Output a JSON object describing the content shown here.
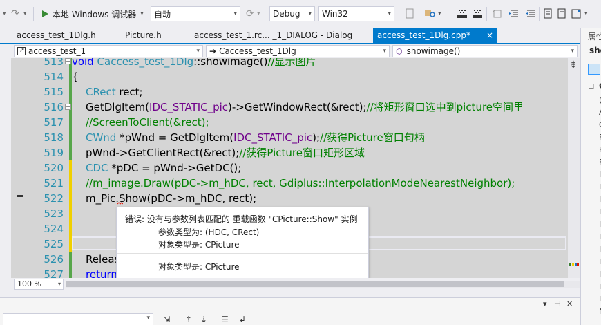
{
  "toolbar": {
    "run_label": "本地 Windows 调试器",
    "run_dropdown": "▾",
    "config_value": "自动",
    "build_config": "Debug",
    "platform": "Win32"
  },
  "tabs": [
    {
      "label": "access_test_1Dlg.h"
    },
    {
      "label": "Picture.h"
    },
    {
      "label": "access_test_1.rc... _1_DIALOG - Dialog"
    },
    {
      "label": "access_test_1Dlg.cpp*"
    }
  ],
  "active_tab_close": "×",
  "navbar": {
    "project": "access_test_1",
    "class": "Caccess_test_1Dlg",
    "member": "showimage()"
  },
  "code": {
    "line_numbers": [
      "513",
      "514",
      "515",
      "516",
      "517",
      "518",
      "519",
      "520",
      "521",
      "522",
      "523",
      "524",
      "525",
      "526",
      "527"
    ],
    "l513": {
      "kw": "void",
      "ty": "Caccess_test_1Dlg",
      "plain": "::showimage()",
      "cm": "//显示图片"
    },
    "l514": "{",
    "l515": {
      "ty": "CRect",
      "plain": " rect;"
    },
    "l516": {
      "plain1": "GetDlgItem(",
      "mc": "IDC_STATIC_pic",
      "plain2": ")->GetWindowRect(&rect);",
      "cm": "//将矩形窗口选中到picture空间里"
    },
    "l517": "//ScreenToClient(&rect);",
    "l518": {
      "ty": "CWnd",
      "plain1": " *pWnd = GetDlgItem(",
      "mc": "IDC_STATIC_pic",
      "plain2": ");",
      "cm": "//获得Picture窗口句柄"
    },
    "l519": {
      "plain": "pWnd->GetClientRect(&rect);",
      "cm": "//获得Picture窗口矩形区域"
    },
    "l520": {
      "ty": "CDC",
      "plain": " *pDC = pWnd->GetDC();"
    },
    "l521": "//m_image.Draw(pDC->m_hDC, rect, Gdiplus::InterpolationModeNearestNeighbor);",
    "l522": "m_Pic.Show(pDC->m_hDC, rect);",
    "l526": "Releas",
    "l527": "return"
  },
  "tooltip": {
    "error": "错误: 没有与参数列表匹配的 重载函数 \"CPicture::Show\" 实例",
    "arg_types": "参数类型为:  (HDC, CRect)",
    "obj_type": "对象类型是:  CPicture",
    "obj_type2": "对象类型是:  CPicture"
  },
  "zoom": "100 %",
  "properties": {
    "title": "属性",
    "object": "sho",
    "section": "G",
    "letters": [
      "(",
      "A",
      "C",
      "F",
      "F",
      "F",
      "I",
      "I",
      "I",
      "I",
      "I",
      "I",
      "I",
      "I",
      "I",
      "I",
      "I",
      "N"
    ]
  }
}
